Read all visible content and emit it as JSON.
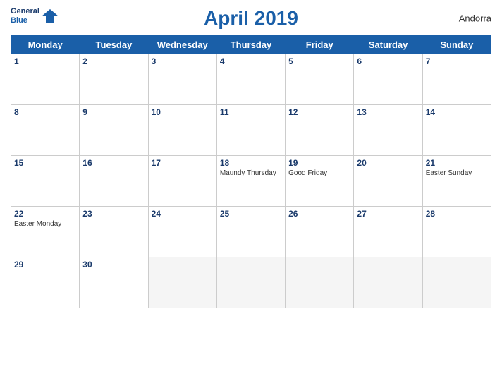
{
  "header": {
    "title": "April 2019",
    "country": "Andorra",
    "logo_line1": "General",
    "logo_line2": "Blue"
  },
  "weekdays": [
    "Monday",
    "Tuesday",
    "Wednesday",
    "Thursday",
    "Friday",
    "Saturday",
    "Sunday"
  ],
  "weeks": [
    [
      {
        "date": "1",
        "holiday": ""
      },
      {
        "date": "2",
        "holiday": ""
      },
      {
        "date": "3",
        "holiday": ""
      },
      {
        "date": "4",
        "holiday": ""
      },
      {
        "date": "5",
        "holiday": ""
      },
      {
        "date": "6",
        "holiday": ""
      },
      {
        "date": "7",
        "holiday": ""
      }
    ],
    [
      {
        "date": "8",
        "holiday": ""
      },
      {
        "date": "9",
        "holiday": ""
      },
      {
        "date": "10",
        "holiday": ""
      },
      {
        "date": "11",
        "holiday": ""
      },
      {
        "date": "12",
        "holiday": ""
      },
      {
        "date": "13",
        "holiday": ""
      },
      {
        "date": "14",
        "holiday": ""
      }
    ],
    [
      {
        "date": "15",
        "holiday": ""
      },
      {
        "date": "16",
        "holiday": ""
      },
      {
        "date": "17",
        "holiday": ""
      },
      {
        "date": "18",
        "holiday": "Maundy Thursday"
      },
      {
        "date": "19",
        "holiday": "Good Friday"
      },
      {
        "date": "20",
        "holiday": ""
      },
      {
        "date": "21",
        "holiday": "Easter Sunday"
      }
    ],
    [
      {
        "date": "22",
        "holiday": "Easter Monday"
      },
      {
        "date": "23",
        "holiday": ""
      },
      {
        "date": "24",
        "holiday": ""
      },
      {
        "date": "25",
        "holiday": ""
      },
      {
        "date": "26",
        "holiday": ""
      },
      {
        "date": "27",
        "holiday": ""
      },
      {
        "date": "28",
        "holiday": ""
      }
    ],
    [
      {
        "date": "29",
        "holiday": ""
      },
      {
        "date": "30",
        "holiday": ""
      },
      {
        "date": "",
        "holiday": ""
      },
      {
        "date": "",
        "holiday": ""
      },
      {
        "date": "",
        "holiday": ""
      },
      {
        "date": "",
        "holiday": ""
      },
      {
        "date": "",
        "holiday": ""
      }
    ]
  ]
}
